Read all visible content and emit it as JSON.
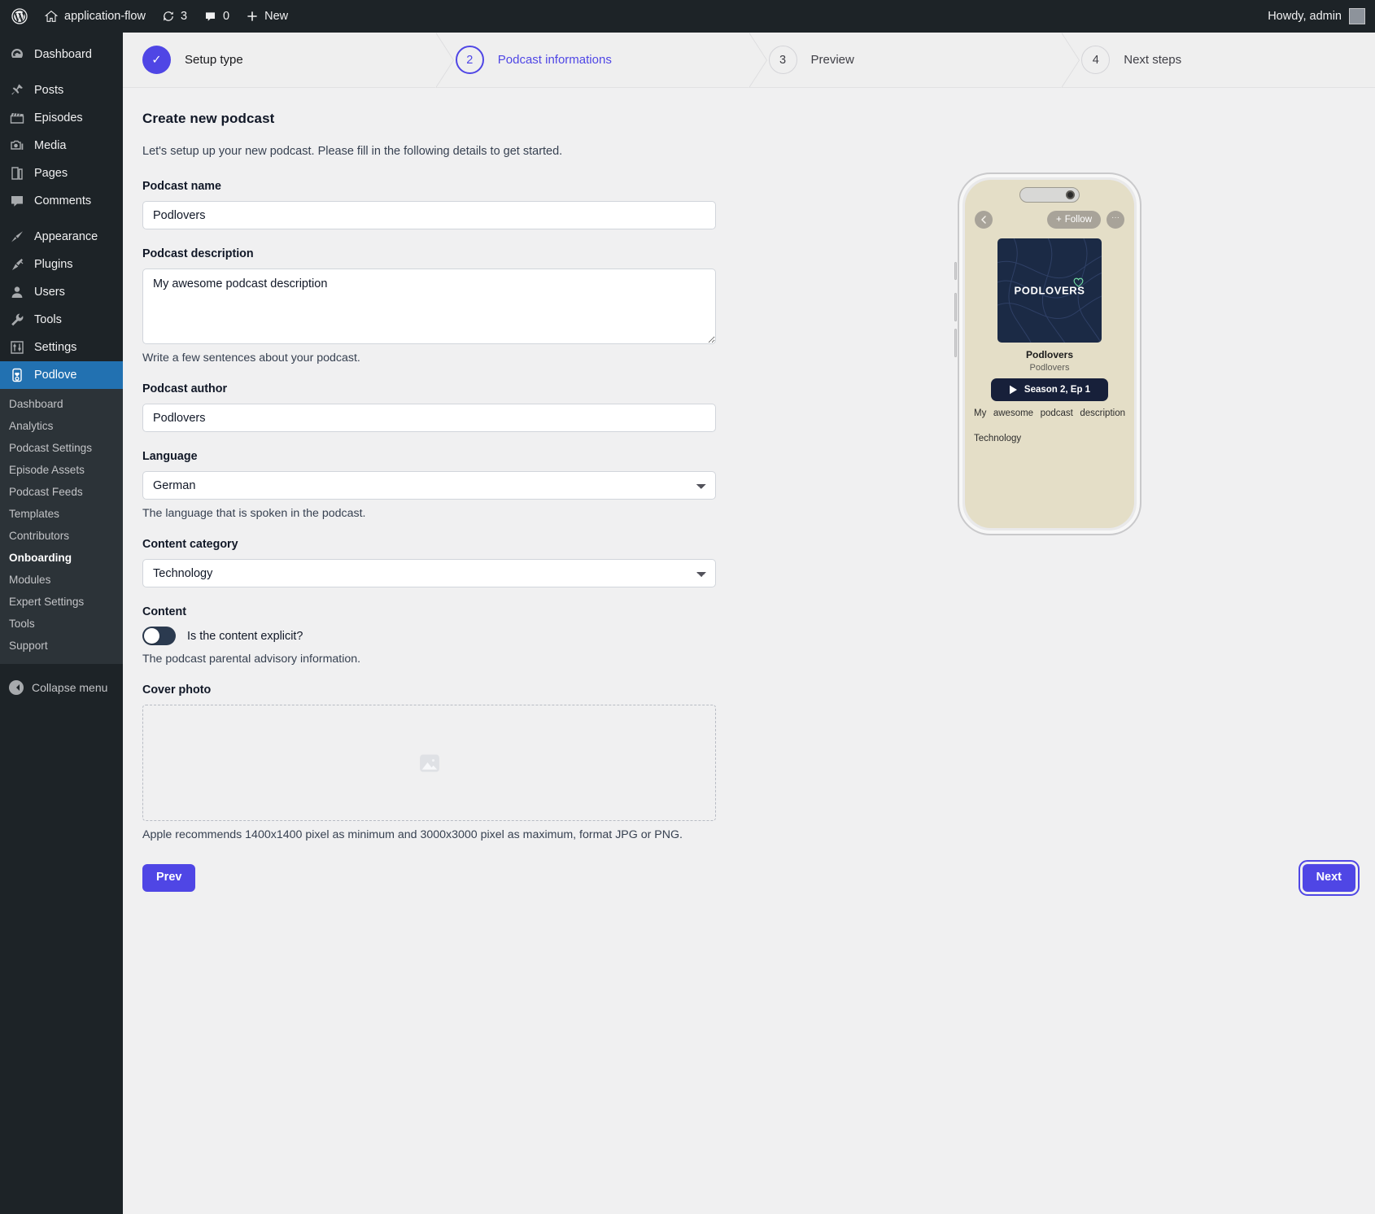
{
  "adminbar": {
    "wp_logo": "wordpress-logo-icon",
    "site_name": "application-flow",
    "updates_count": "3",
    "comments_count": "0",
    "new_label": "New",
    "howdy": "Howdy, admin"
  },
  "sidebar": {
    "items": [
      {
        "label": "Dashboard",
        "icon": "dashboard-icon"
      },
      {
        "label": "Posts",
        "icon": "pin-icon"
      },
      {
        "label": "Episodes",
        "icon": "clapperboard-icon"
      },
      {
        "label": "Media",
        "icon": "camera-icon"
      },
      {
        "label": "Pages",
        "icon": "page-icon"
      },
      {
        "label": "Comments",
        "icon": "comment-icon"
      },
      {
        "label": "Appearance",
        "icon": "paintbrush-icon"
      },
      {
        "label": "Plugins",
        "icon": "plug-icon"
      },
      {
        "label": "Users",
        "icon": "user-icon"
      },
      {
        "label": "Tools",
        "icon": "wrench-icon"
      },
      {
        "label": "Settings",
        "icon": "sliders-icon"
      },
      {
        "label": "Podlove",
        "icon": "podlove-icon"
      }
    ],
    "submenu": [
      "Dashboard",
      "Analytics",
      "Podcast Settings",
      "Episode Assets",
      "Podcast Feeds",
      "Templates",
      "Contributors",
      "Onboarding",
      "Modules",
      "Expert Settings",
      "Tools",
      "Support"
    ],
    "active_submenu": "Onboarding",
    "collapse_label": "Collapse menu"
  },
  "stepper": {
    "steps": [
      {
        "badge": "✓",
        "label": "Setup type",
        "state": "done"
      },
      {
        "badge": "2",
        "label": "Podcast informations",
        "state": "active"
      },
      {
        "badge": "3",
        "label": "Preview",
        "state": "todo"
      },
      {
        "badge": "4",
        "label": "Next steps",
        "state": "todo"
      }
    ]
  },
  "form": {
    "title": "Create new podcast",
    "lede": "Let's setup up your new podcast. Please fill in the following details to get started.",
    "name_label": "Podcast name",
    "name_value": "Podlovers",
    "description_label": "Podcast description",
    "description_value": "My awesome podcast description",
    "description_hint": "Write a few sentences about your podcast.",
    "author_label": "Podcast author",
    "author_value": "Podlovers",
    "language_label": "Language",
    "language_value": "German",
    "language_hint": "The language that is spoken in the podcast.",
    "category_label": "Content category",
    "category_value": "Technology",
    "content_label": "Content",
    "explicit_label": "Is the content explicit?",
    "explicit_value": "off",
    "explicit_hint": "The podcast parental advisory information.",
    "cover_label": "Cover photo",
    "cover_placeholder_icon": "image-placeholder-icon",
    "cover_hint": "Apple recommends 1400x1400 pixel as minimum and 3000x3000 pixel as maximum, format JPG or PNG.",
    "prev_label": "Prev",
    "next_label": "Next"
  },
  "preview": {
    "back_icon": "chevron-left-icon",
    "follow_label": "Follow",
    "follow_plus": "+",
    "more_label": "···",
    "cover_wordmark": "PODLOVERS",
    "heart_icon": "heart-outline-icon",
    "title": "Podlovers",
    "author": "Podlovers",
    "play_icon": "play-icon",
    "episode_label": "Season 2, Ep 1",
    "description": "My awesome podcast description",
    "category": "Technology"
  },
  "colors": {
    "accent": "#4f46e5",
    "admin_bg": "#1d2327",
    "admin_current": "#2271b1",
    "page_bg": "#f0f0f1",
    "phone_screen": "#e4dec7",
    "cover_bg": "#1b2a45",
    "heart": "#77e6a8"
  }
}
